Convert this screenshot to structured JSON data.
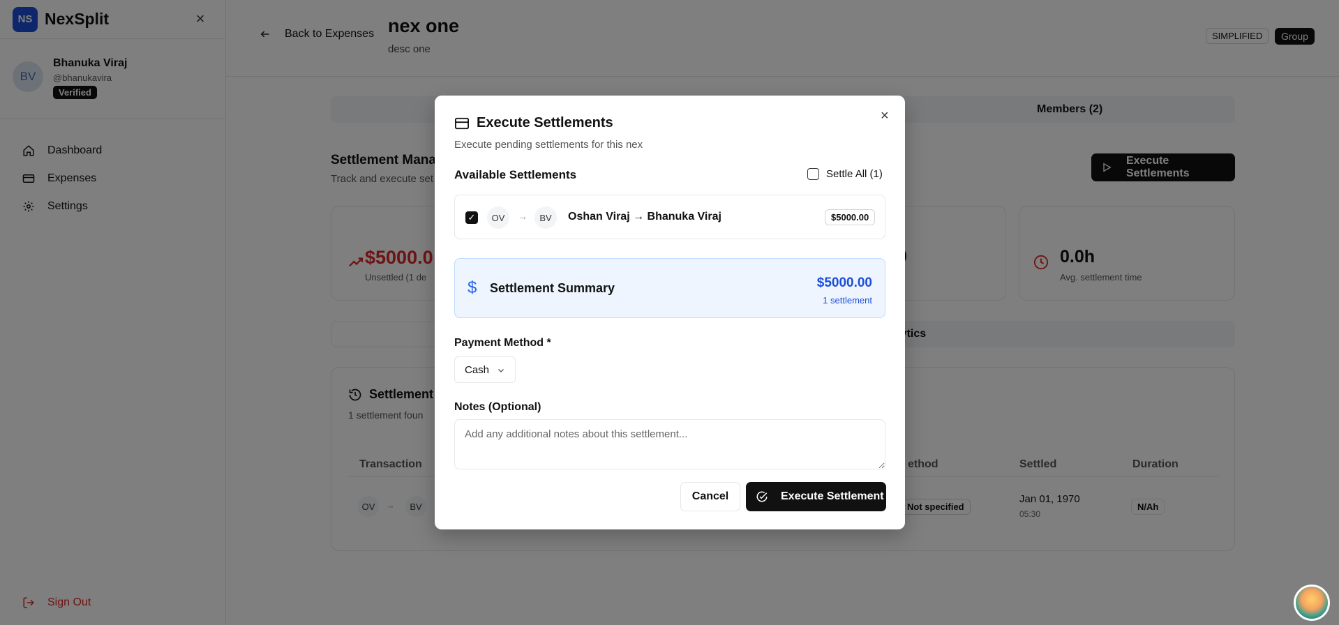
{
  "brand": {
    "logo": "NS",
    "name": "NexSplit",
    "close_icon": "×"
  },
  "user": {
    "initials": "BV",
    "name": "Bhanuka Viraj",
    "handle": "@bhanukavira",
    "badge": "Verified"
  },
  "nav": [
    {
      "label": "Dashboard",
      "icon": "home-icon"
    },
    {
      "label": "Expenses",
      "icon": "card-icon"
    },
    {
      "label": "Settings",
      "icon": "gear-icon"
    }
  ],
  "signout": "Sign Out",
  "header": {
    "back": "Back to Expenses",
    "title": "nex one",
    "subtitle": "desc one",
    "pill_simplified": "SIMPLIFIED",
    "pill_group": "Group"
  },
  "tabs": {
    "members": "Members (2)"
  },
  "section": {
    "title": "Settlement Mana",
    "subtitle": "Track and execute set",
    "execute_btn": "Execute Settlements"
  },
  "stats": {
    "unsettled_value": "$5000.0",
    "unsettled_label": "Unsettled (1 de",
    "mid_value": "0",
    "time_value": "0.0h",
    "time_label": "Avg. settlement time"
  },
  "subtabs": {
    "analytics": "Analytics"
  },
  "history": {
    "title": "Settlement",
    "subtitle": "1 settlement foun",
    "columns": {
      "transaction": "Transaction",
      "method": "ethod",
      "settled": "Settled",
      "duration": "Duration"
    },
    "row": {
      "from": "OV",
      "to": "BV",
      "arrow": "→",
      "method": "Not specified",
      "date": "Jan 01, 1970",
      "time": "05:30",
      "duration": "N/Ah"
    }
  },
  "dialog": {
    "title": "Execute Settlements",
    "subtitle": "Execute pending settlements for this nex",
    "available": "Available Settlements",
    "settle_all": "Settle All (1)",
    "item": {
      "from": "OV",
      "to": "BV",
      "arrow": "→",
      "check": "✓",
      "names": "Oshan Viraj → Bhanuka Viraj",
      "amount": "$5000.00"
    },
    "summary": {
      "icon": "$",
      "title": "Settlement Summary",
      "amount": "$5000.00",
      "count": "1 settlement"
    },
    "payment_label": "Payment Method *",
    "payment_value": "Cash",
    "notes_label": "Notes (Optional)",
    "notes_placeholder": "Add any additional notes about this settlement...",
    "cancel": "Cancel",
    "execute": "Execute Settlement",
    "close_icon": "×"
  }
}
